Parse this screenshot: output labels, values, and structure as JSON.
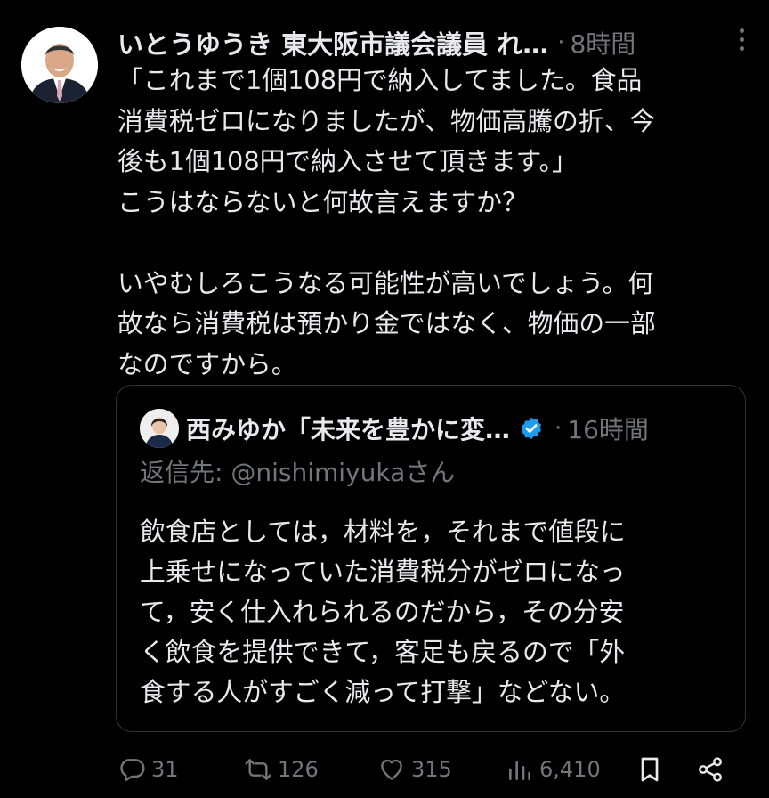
{
  "tweet": {
    "author_name": "いとうゆうき 東大阪市議会議員 れ…",
    "separator": "·",
    "time": "8時間",
    "text": "「これまで1個108円で納入してました。食品\n消費税ゼロになりましたが、物価高騰の折、今\n後も1個108円で納入させて頂きます。」\nこうはならないと何故言えますか？\n\nいやむしろこうなる可能性が高いでしょう。何\n故なら消費税は預かり金ではなく、物価の一部\nなのですから。"
  },
  "quote": {
    "author_name": "西みゆか「未来を豊かに変…",
    "separator": "·",
    "time": "16時間",
    "reply_to": "返信先: @nishimiyukaさん",
    "text": "飲食店としては，材料を，それまで値段に\n上乗せになっていた消費税分がゼロになっ\nて，安く仕入れられるのだから，その分安\nく飲食を提供できて，客足も戻るので「外\n食する人がすごく減って打撃」などない。"
  },
  "actions": {
    "reply_count": "31",
    "retweet_count": "126",
    "like_count": "315",
    "view_count": "6,410"
  },
  "colors": {
    "background": "#000000",
    "text": "#e7e9ea",
    "muted": "#71767b",
    "border": "#2f3336",
    "verified": "#1d9bf0"
  },
  "icons": [
    "avatar",
    "more-icon",
    "verified-icon",
    "reply-icon",
    "retweet-icon",
    "like-icon",
    "views-icon",
    "bookmark-icon",
    "share-icon"
  ]
}
